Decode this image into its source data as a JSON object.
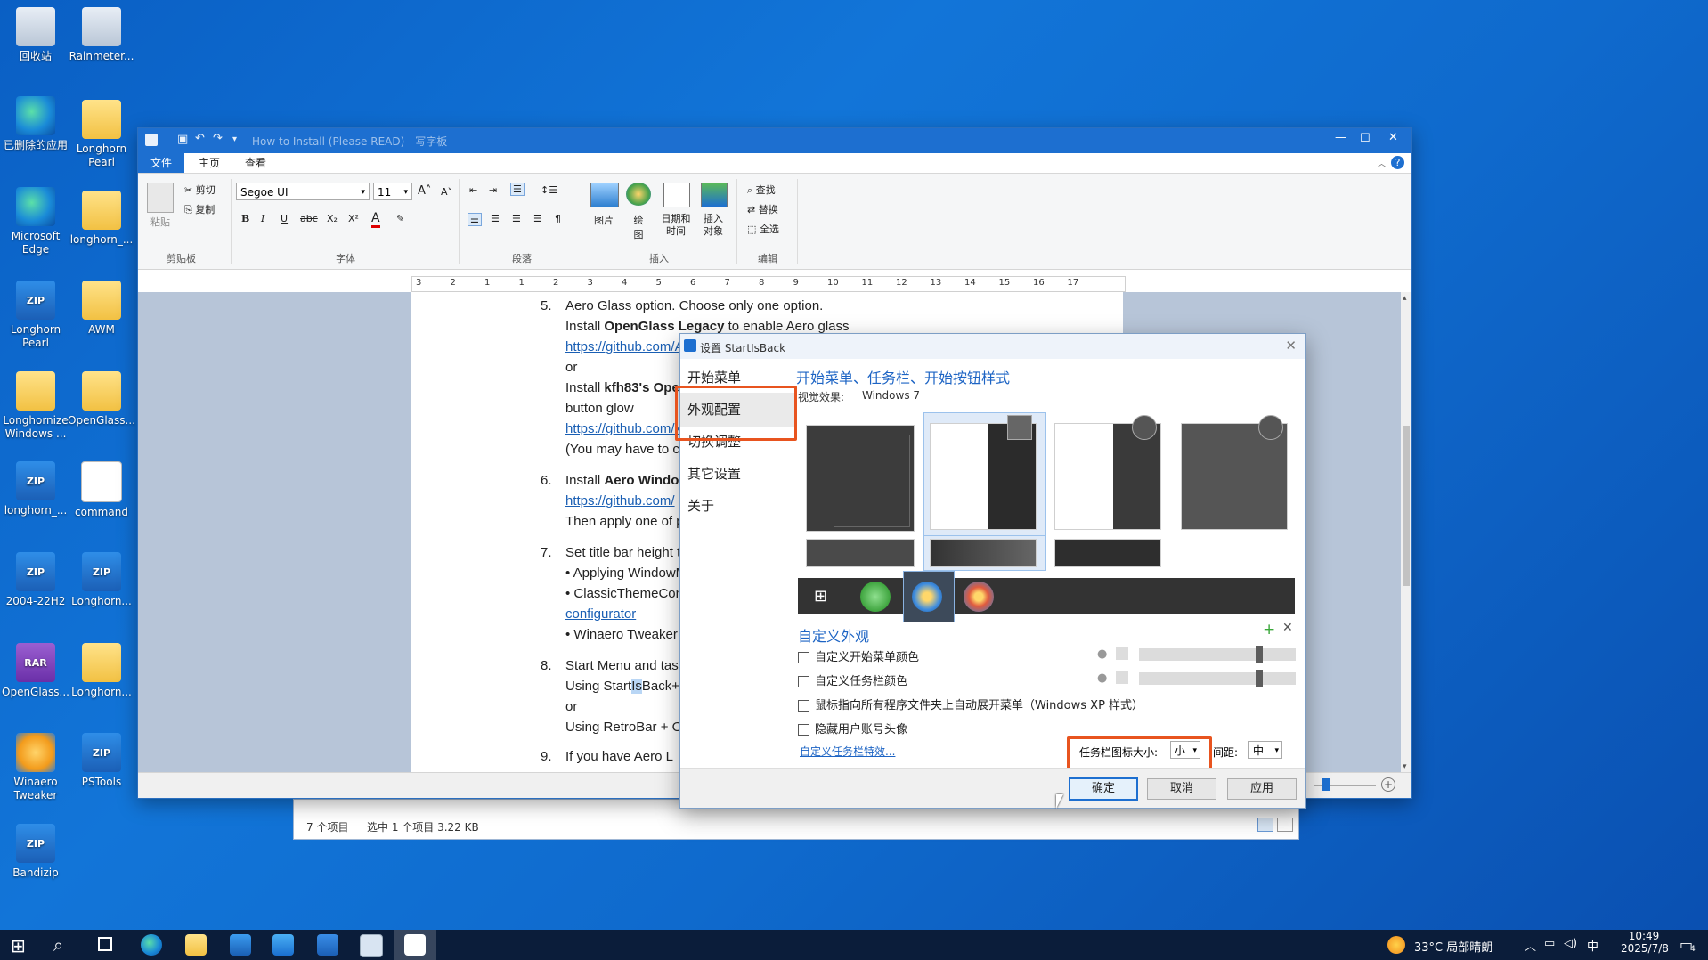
{
  "desktop": {
    "icons": [
      {
        "label": "回收站",
        "icon": "recycle-bin-icon"
      },
      {
        "label": "Rainmeter...",
        "icon": "rainmeter-icon"
      },
      {
        "label": "已删除的应用",
        "icon": "edge-icon"
      },
      {
        "label": "Longhorn Pearl",
        "icon": "folder-icon"
      },
      {
        "label": "Microsoft Edge",
        "icon": "edge-icon"
      },
      {
        "label": "longhorn_...",
        "icon": "folder-icon"
      },
      {
        "label": "Longhorn Pearl",
        "icon": "zip-icon"
      },
      {
        "label": "AWM",
        "icon": "folder-icon"
      },
      {
        "label": "Longhornize Windows ...",
        "icon": "folder-icon"
      },
      {
        "label": "OpenGlass...",
        "icon": "folder-icon"
      },
      {
        "label": "longhorn_...",
        "icon": "zip-icon"
      },
      {
        "label": "command",
        "icon": "document-icon"
      },
      {
        "label": "2004-22H2",
        "icon": "zip-icon"
      },
      {
        "label": "Longhorn...",
        "icon": "zip-icon"
      },
      {
        "label": "OpenGlass...",
        "icon": "rar-icon"
      },
      {
        "label": "Longhorn...",
        "icon": "folder-icon"
      },
      {
        "label": "Winaero Tweaker",
        "icon": "winaero-icon"
      },
      {
        "label": "PSTools",
        "icon": "zip-icon"
      },
      {
        "label": "Bandizip",
        "icon": "zip-icon"
      }
    ]
  },
  "wordpad": {
    "title": "How to Install (Please READ) - 写字板",
    "tabs": [
      "文件",
      "主页",
      "查看"
    ],
    "clipboard": {
      "paste": "粘贴",
      "cut": "剪切",
      "copy": "复制",
      "group": "剪贴板"
    },
    "font": {
      "name": "Segoe UI",
      "size": "11",
      "group": "字体"
    },
    "paragraph_group": "段落",
    "insert": {
      "picture": "图片",
      "draw": "绘图",
      "datetime": "日期和时间",
      "object": "插入对象",
      "group": "插入"
    },
    "edit": {
      "find": "查找",
      "replace": "替换",
      "select_all": "全选",
      "group": "编辑"
    },
    "ruler_marks": [
      "3",
      "2",
      "1",
      "1",
      "2",
      "3",
      "4",
      "5",
      "6",
      "7",
      "8",
      "9",
      "10",
      "11",
      "12",
      "13",
      "14",
      "15",
      "16",
      "17"
    ],
    "doc": {
      "l1_num": "5.",
      "l1": "Aero Glass option. Choose only one option.",
      "l2a": "Install ",
      "l2b": "OpenGlass Legacy",
      "l2c": " to enable Aero glass",
      "l3": "https://github.com/ALTaleX531/OpenGlass",
      "l4": "or",
      "l5a": "Install ",
      "l5b": "kfh83's Ope",
      "l6": "button glow",
      "l7": "https://github.com/k",
      "l8": "(You may have to co",
      "l9_num": "6.",
      "l9a": "Install ",
      "l9b": "Aero Window",
      "l10": "https://github.com/",
      "l11": "Then apply one of pr",
      "l12_num": "7.",
      "l12": "Set title bar height t",
      "l13": "• Applying WindowM",
      "l14": "• ClassicThemeConfi",
      "l15": "configurator",
      "l16": "• Winaero Tweaker u",
      "l17_num": "8.",
      "l17": "Start Menu and taskb",
      "l18a": "Using Start",
      "l18b": "Is",
      "l18c": "Back++",
      "l19": "or",
      "l20": "Using RetroBar + Op",
      "l21_num": "9.",
      "l21": "If you have Aero L"
    }
  },
  "explorer_strip": {
    "items": "7 个项目",
    "selected": "选中 1 个项目  3.22 KB"
  },
  "startisback": {
    "title": "设置 StartIsBack",
    "nav": [
      "开始菜单",
      "外观配置",
      "切换调整",
      "其它设置",
      "关于"
    ],
    "active_nav": "外观配置",
    "heading": "开始菜单、任务栏、开始按钮样式",
    "visual_label": "视觉效果:",
    "visual_value": "Windows 7",
    "custom_heading": "自定义外观",
    "checkboxes": [
      {
        "label": "自定义开始菜单颜色",
        "checked": false
      },
      {
        "label": "自定义任务栏颜色",
        "checked": false
      },
      {
        "label": "鼠标指向所有程序文件夹上自动展开菜单（Windows XP 样式）",
        "checked": false
      },
      {
        "label": "隐藏用户账号头像",
        "checked": false
      }
    ],
    "taskbar_effects_link": "自定义任务栏特效...",
    "icon_size_label": "任务栏图标大小:",
    "icon_size_value": "小",
    "spacing_label": "间距:",
    "spacing_value": "中",
    "ok": "确定",
    "cancel": "取消",
    "apply": "应用",
    "accent": "#1d64c4",
    "highlight": "#e8541f"
  },
  "taskbar": {
    "weather": "33°C  局部晴朗",
    "ime": "中",
    "time": "10:49",
    "date": "2025/7/8",
    "notif_count": "4"
  }
}
